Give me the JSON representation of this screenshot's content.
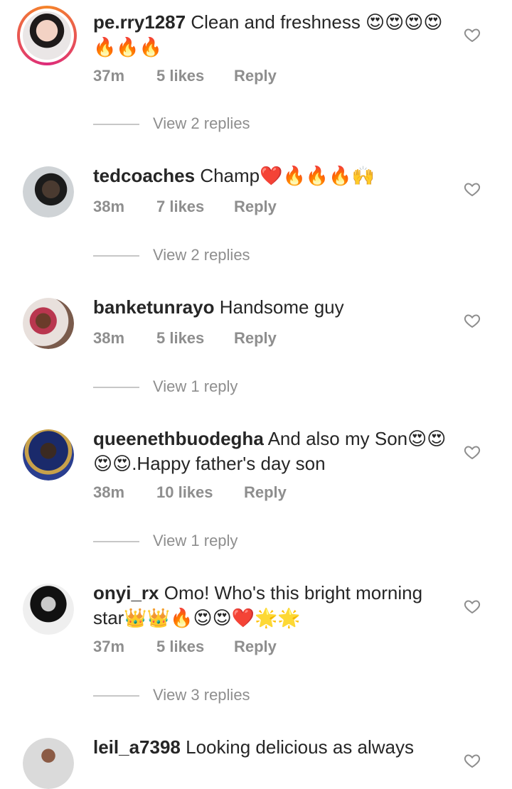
{
  "comments": [
    {
      "username": "pe.rry1287",
      "text": "Clean and freshness 😍😍😍😍🔥🔥🔥",
      "time": "37m",
      "likes": "5 likes",
      "reply": "Reply",
      "view_replies": "View 2 replies"
    },
    {
      "username": "tedcoaches",
      "text": "Champ❤️🔥🔥🔥🙌",
      "time": "38m",
      "likes": "7 likes",
      "reply": "Reply",
      "view_replies": "View 2 replies"
    },
    {
      "username": "banketunrayo",
      "text": "Handsome guy",
      "time": "38m",
      "likes": "5 likes",
      "reply": "Reply",
      "view_replies": "View 1 reply"
    },
    {
      "username": "queenethbuodegha",
      "text": "And also my Son😍😍😍😍.Happy father's day son",
      "time": "38m",
      "likes": "10 likes",
      "reply": "Reply",
      "view_replies": "View 1 reply"
    },
    {
      "username": "onyi_rx",
      "text": "Omo! Who's this bright morning star👑👑🔥😍😍❤️🌟🌟",
      "time": "37m",
      "likes": "5 likes",
      "reply": "Reply",
      "view_replies": "View 3 replies"
    },
    {
      "username": "leil_a7398",
      "text": "Looking delicious as always"
    }
  ],
  "icons": {
    "like": "heart-outline-icon"
  },
  "colors": {
    "text": "#262626",
    "secondary": "#8e8e8e",
    "story_ring_start": "#f58529",
    "story_ring_end": "#dd2a7b"
  }
}
